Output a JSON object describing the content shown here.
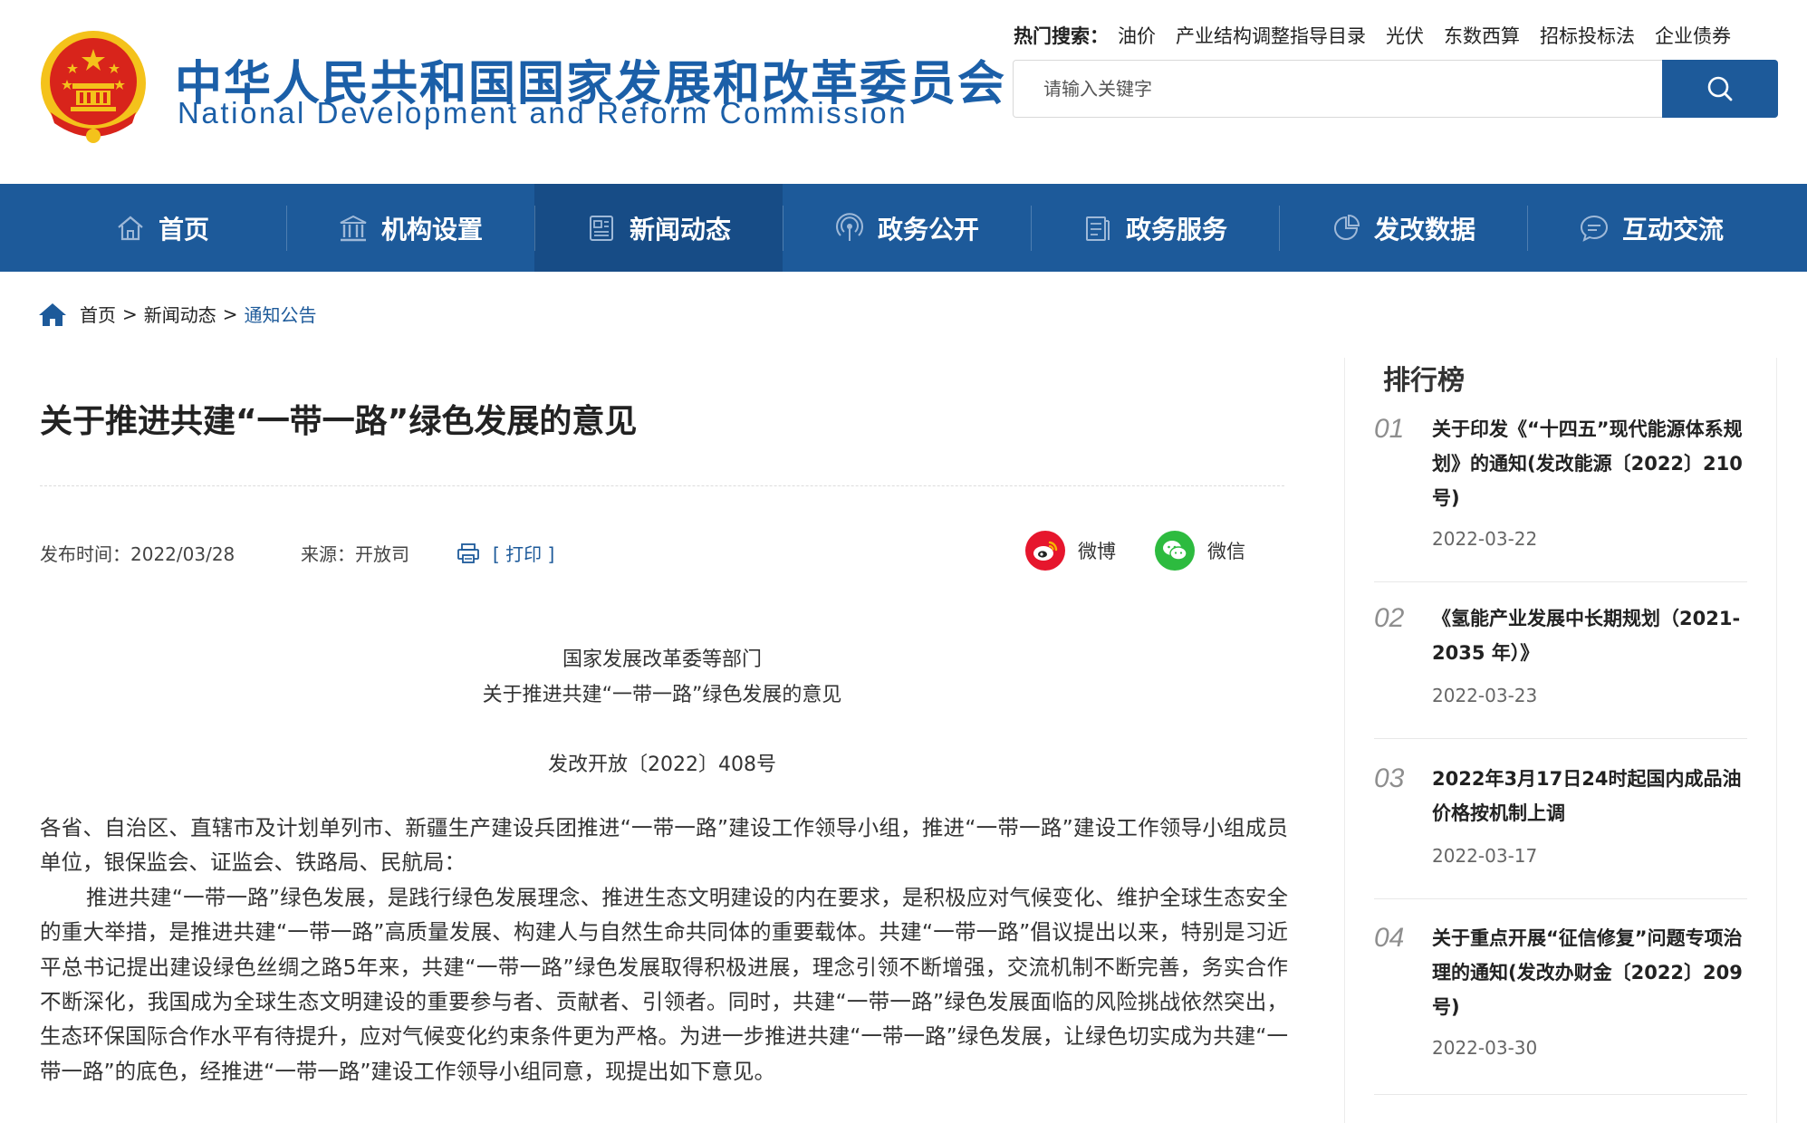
{
  "header": {
    "title_cn": "中华人民共和国国家发展和改革委员会",
    "title_en": "National Development and Reform Commission",
    "hot_search_label": "热门搜索：",
    "hot_search": [
      "油价",
      "产业结构调整指导目录",
      "光伏",
      "东数西算",
      "招标投标法",
      "企业债券"
    ],
    "search_placeholder": "请输入关键字"
  },
  "nav": [
    {
      "label": "首页",
      "icon": "home-icon"
    },
    {
      "label": "机构设置",
      "icon": "institution-icon"
    },
    {
      "label": "新闻动态",
      "icon": "news-icon",
      "active": true
    },
    {
      "label": "政务公开",
      "icon": "broadcast-icon"
    },
    {
      "label": "政务服务",
      "icon": "service-icon"
    },
    {
      "label": "发改数据",
      "icon": "data-chart-icon"
    },
    {
      "label": "互动交流",
      "icon": "chat-icon"
    }
  ],
  "breadcrumb": {
    "items": [
      "首页",
      "新闻动态",
      "通知公告"
    ],
    "separator": ">"
  },
  "article": {
    "title": "关于推进共建“一带一路”绿色发展的意见",
    "publish_label": "发布时间：",
    "publish_date": "2022/03/28",
    "source_label": "来源：",
    "source": "开放司",
    "print_label": "[ 打印 ]",
    "share_weibo": "微博",
    "share_wechat": "微信",
    "doc_issuer": "国家发展改革委等部门",
    "doc_title": "关于推进共建“一带一路”绿色发展的意见",
    "doc_number": "发改开放〔2022〕408号",
    "paragraph_1": "各省、自治区、直辖市及计划单列市、新疆生产建设兵团推进“一带一路”建设工作领导小组，推进“一带一路”建设工作领导小组成员单位，银保监会、证监会、铁路局、民航局：",
    "paragraph_2": "推进共建“一带一路”绿色发展，是践行绿色发展理念、推进生态文明建设的内在要求，是积极应对气候变化、维护全球生态安全的重大举措，是推进共建“一带一路”高质量发展、构建人与自然生命共同体的重要载体。共建“一带一路”倡议提出以来，特别是习近平总书记提出建设绿色丝绸之路5年来，共建“一带一路”绿色发展取得积极进展，理念引领不断增强，交流机制不断完善，务实合作不断深化，我国成为全球生态文明建设的重要参与者、贡献者、引领者。同时，共建“一带一路”绿色发展面临的风险挑战依然突出，生态环保国际合作水平有待提升，应对气候变化约束条件更为严格。为进一步推进共建“一带一路”绿色发展，让绿色切实成为共建“一带一路”的底色，经推进“一带一路”建设工作领导小组同意，现提出如下意见。"
  },
  "sidebar": {
    "title": "排行榜",
    "items": [
      {
        "no": "01",
        "text": "关于印发《“十四五”现代能源体系规划》的通知(发改能源〔2022〕210号)",
        "date": "2022-03-22"
      },
      {
        "no": "02",
        "text": "《氢能产业发展中长期规划（2021-2035 年）》",
        "date": "2022-03-23"
      },
      {
        "no": "03",
        "text": "2022年3月17日24时起国内成品油价格按机制上调",
        "date": "2022-03-17"
      },
      {
        "no": "04",
        "text": "关于重点开展“征信修复”问题专项治理的通知(发改办财金〔2022〕209号)",
        "date": "2022-03-30"
      }
    ]
  },
  "colors": {
    "brand_blue": "#1d5a9a",
    "nav_active": "#174c86",
    "weibo_red": "#e6162d",
    "wechat_green": "#2dbb3f",
    "emblem_red": "#d8241b",
    "emblem_gold": "#f4c21b"
  }
}
